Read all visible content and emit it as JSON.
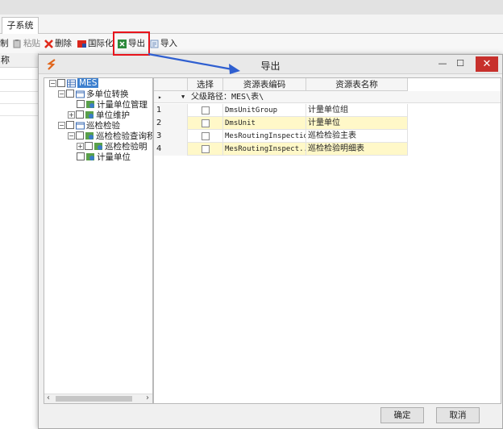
{
  "tabs": [
    {
      "label": "子系统"
    }
  ],
  "toolbar": {
    "items": [
      {
        "label": "制"
      },
      {
        "label": "粘贴"
      },
      {
        "label": "删除"
      },
      {
        "label": "国际化"
      },
      {
        "label": "导出"
      },
      {
        "label": "导入"
      }
    ]
  },
  "bg_grid": {
    "header": "称"
  },
  "dialog": {
    "title": "导出",
    "minimize": "—",
    "restore": "☐",
    "close": "✕",
    "ok_label": "确定",
    "cancel_label": "取消"
  },
  "tree": {
    "nodes": [
      {
        "label": "MES"
      },
      {
        "label": "多单位转换"
      },
      {
        "label": "计量单位管理"
      },
      {
        "label": "单位维护"
      },
      {
        "label": "巡检检验"
      },
      {
        "label": "巡检检验查询积"
      },
      {
        "label": "巡检检验明"
      },
      {
        "label": "计量单位"
      }
    ]
  },
  "grid": {
    "columns": [
      "选择",
      "资源表编码",
      "资源表名称"
    ],
    "group_label": "父级路径：MES\\表\\",
    "rows": [
      {
        "num": "1",
        "code": "DmsUnitGroup",
        "name": "计量单位组"
      },
      {
        "num": "2",
        "code": "DmsUnit",
        "name": "计量单位"
      },
      {
        "num": "3",
        "code": "MesRoutingInspection",
        "name": "巡检检验主表"
      },
      {
        "num": "4",
        "code": "MesRoutingInspect...",
        "name": "巡检检验明细表"
      }
    ]
  },
  "colors": {
    "highlight_box": "#e8141c",
    "arrow": "#2f5fd0",
    "close_button": "#c7302c",
    "selection": "#3d80cf",
    "row_highlight": "#fff8c8"
  }
}
